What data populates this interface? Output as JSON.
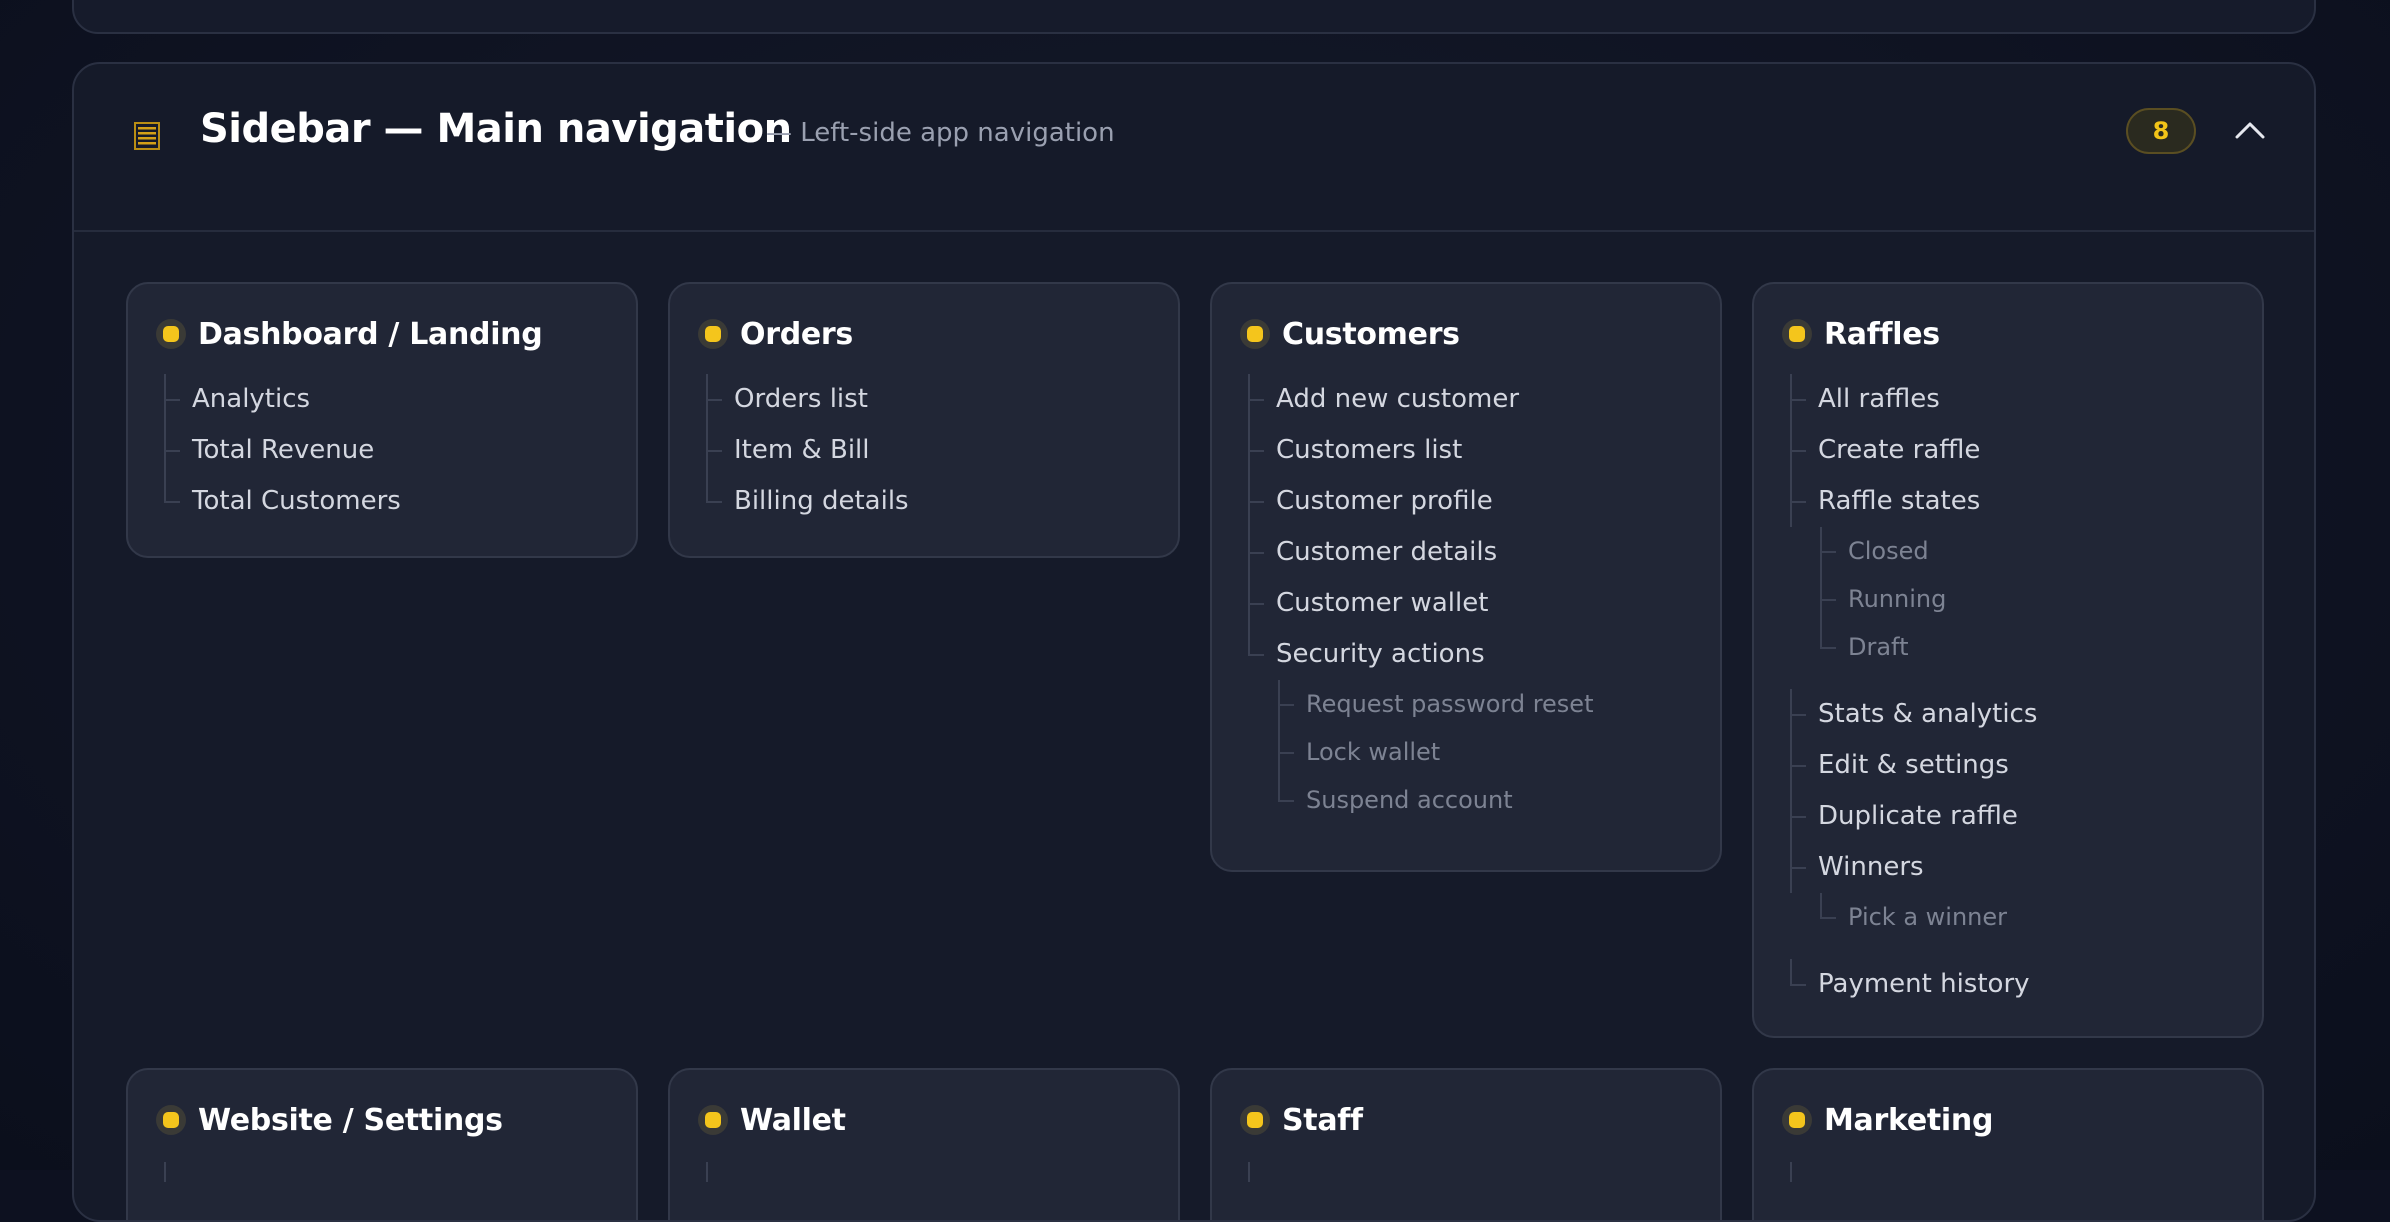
{
  "panel": {
    "title": "Sidebar — Main navigation",
    "subtitle": "— Left-side app navigation",
    "count": "8"
  },
  "accent_color": "#f4c51c",
  "cards": {
    "dashboard": {
      "title": "Dashboard / Landing",
      "items": [
        "Analytics",
        "Total Revenue",
        "Total Customers"
      ]
    },
    "orders": {
      "title": "Orders",
      "items": [
        "Orders list",
        "Item & Bill",
        "Billing details"
      ]
    },
    "customers": {
      "title": "Customers",
      "items": [
        "Add new customer",
        "Customers list",
        "Customer profile",
        "Customer details",
        "Customer wallet",
        "Security actions"
      ],
      "security_sub": [
        "Request password reset",
        "Lock wallet",
        "Suspend account"
      ]
    },
    "raffles": {
      "title": "Raffles",
      "items": [
        "All raffles",
        "Create raffle",
        "Raffle states",
        "Stats & analytics",
        "Edit & settings",
        "Duplicate raffle",
        "Winners",
        "Payment history"
      ],
      "states_sub": [
        "Closed",
        "Running",
        "Draft"
      ],
      "winners_sub": [
        "Pick a winner"
      ]
    },
    "website": {
      "title": "Website / Settings"
    },
    "wallet": {
      "title": "Wallet"
    },
    "staff": {
      "title": "Staff"
    },
    "marketing": {
      "title": "Marketing"
    }
  }
}
